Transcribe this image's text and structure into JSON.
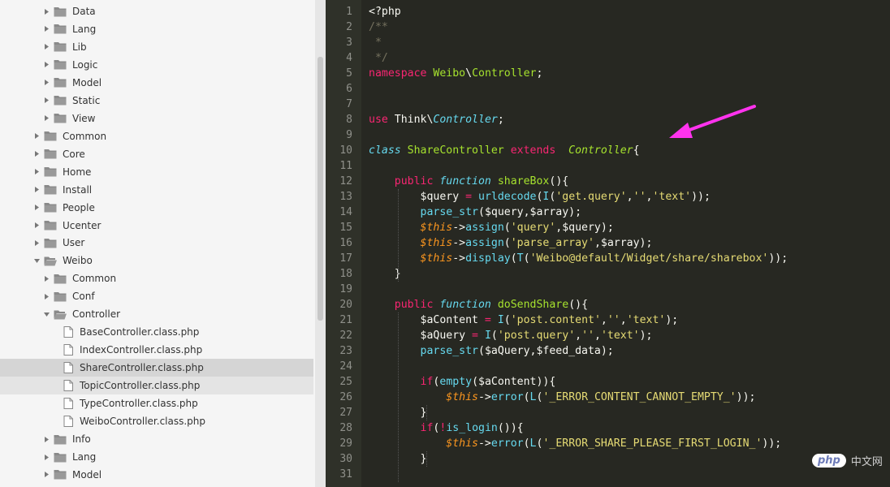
{
  "sidebar": {
    "items": [
      {
        "label": "Data",
        "depth": 2,
        "type": "folder",
        "expanded": false
      },
      {
        "label": "Lang",
        "depth": 2,
        "type": "folder",
        "expanded": false
      },
      {
        "label": "Lib",
        "depth": 2,
        "type": "folder",
        "expanded": false
      },
      {
        "label": "Logic",
        "depth": 2,
        "type": "folder",
        "expanded": false
      },
      {
        "label": "Model",
        "depth": 2,
        "type": "folder",
        "expanded": false
      },
      {
        "label": "Static",
        "depth": 2,
        "type": "folder",
        "expanded": false
      },
      {
        "label": "View",
        "depth": 2,
        "type": "folder",
        "expanded": false
      },
      {
        "label": "Common",
        "depth": 1,
        "type": "folder",
        "expanded": false
      },
      {
        "label": "Core",
        "depth": 1,
        "type": "folder",
        "expanded": false
      },
      {
        "label": "Home",
        "depth": 1,
        "type": "folder",
        "expanded": false
      },
      {
        "label": "Install",
        "depth": 1,
        "type": "folder",
        "expanded": false
      },
      {
        "label": "People",
        "depth": 1,
        "type": "folder",
        "expanded": false
      },
      {
        "label": "Ucenter",
        "depth": 1,
        "type": "folder",
        "expanded": false
      },
      {
        "label": "User",
        "depth": 1,
        "type": "folder",
        "expanded": false
      },
      {
        "label": "Weibo",
        "depth": 1,
        "type": "folder",
        "expanded": true
      },
      {
        "label": "Common",
        "depth": 2,
        "type": "folder",
        "expanded": false
      },
      {
        "label": "Conf",
        "depth": 2,
        "type": "folder",
        "expanded": false
      },
      {
        "label": "Controller",
        "depth": 2,
        "type": "folder",
        "expanded": true
      },
      {
        "label": "BaseController.class.php",
        "depth": 3,
        "type": "file"
      },
      {
        "label": "IndexController.class.php",
        "depth": 3,
        "type": "file"
      },
      {
        "label": "ShareController.class.php",
        "depth": 3,
        "type": "file",
        "state": "selected"
      },
      {
        "label": "TopicController.class.php",
        "depth": 3,
        "type": "file",
        "state": "hover"
      },
      {
        "label": "TypeController.class.php",
        "depth": 3,
        "type": "file"
      },
      {
        "label": "WeiboController.class.php",
        "depth": 3,
        "type": "file"
      },
      {
        "label": "Info",
        "depth": 2,
        "type": "folder",
        "expanded": false
      },
      {
        "label": "Lang",
        "depth": 2,
        "type": "folder",
        "expanded": false
      },
      {
        "label": "Model",
        "depth": 2,
        "type": "folder",
        "expanded": false
      }
    ]
  },
  "editor": {
    "lines": [
      {
        "n": "1",
        "tokens": [
          [
            "<?php",
            ""
          ]
        ]
      },
      {
        "n": "2",
        "tokens": [
          [
            "/**",
            "cm"
          ]
        ]
      },
      {
        "n": "3",
        "tokens": [
          [
            " *",
            "cm"
          ]
        ]
      },
      {
        "n": "4",
        "tokens": [
          [
            " */",
            "cm"
          ]
        ]
      },
      {
        "n": "5",
        "tokens": [
          [
            "namespace",
            "kw"
          ],
          [
            " Weibo",
            "cls"
          ],
          [
            "\\",
            ""
          ],
          [
            "Controller",
            "cls"
          ],
          [
            ";",
            ""
          ]
        ]
      },
      {
        "n": "6",
        "tokens": []
      },
      {
        "n": "7",
        "tokens": []
      },
      {
        "n": "8",
        "tokens": [
          [
            "use",
            "kw"
          ],
          [
            " Think",
            ""
          ],
          [
            "\\",
            ""
          ],
          [
            "Controller",
            "st"
          ],
          [
            ";",
            ""
          ]
        ]
      },
      {
        "n": "9",
        "tokens": []
      },
      {
        "n": "10",
        "tokens": [
          [
            "class",
            "st"
          ],
          [
            " ",
            ""
          ],
          [
            "ShareController",
            "cls"
          ],
          [
            " ",
            ""
          ],
          [
            "extends",
            "kw"
          ],
          [
            "  ",
            ""
          ],
          [
            "Controller",
            "cls it"
          ],
          [
            "{",
            ""
          ]
        ]
      },
      {
        "n": "11",
        "tokens": []
      },
      {
        "n": "12",
        "tokens": [
          [
            "    ",
            ""
          ],
          [
            "public",
            "kw"
          ],
          [
            " ",
            ""
          ],
          [
            "function",
            "st"
          ],
          [
            " ",
            ""
          ],
          [
            "shareBox",
            "fn"
          ],
          [
            "(){",
            ""
          ]
        ]
      },
      {
        "n": "13",
        "tokens": [
          [
            "        $query ",
            ""
          ],
          [
            "=",
            "kw"
          ],
          [
            " ",
            ""
          ],
          [
            "urldecode",
            "bi"
          ],
          [
            "(",
            ""
          ],
          [
            "I",
            "bi"
          ],
          [
            "(",
            ""
          ],
          [
            "'get.query'",
            "str"
          ],
          [
            ",",
            ""
          ],
          [
            "''",
            "str"
          ],
          [
            ",",
            ""
          ],
          [
            "'text'",
            "str"
          ],
          [
            "));",
            ""
          ]
        ]
      },
      {
        "n": "14",
        "tokens": [
          [
            "        ",
            ""
          ],
          [
            "parse_str",
            "bi"
          ],
          [
            "($query,$array);",
            ""
          ]
        ]
      },
      {
        "n": "15",
        "tokens": [
          [
            "        ",
            ""
          ],
          [
            "$this",
            "var"
          ],
          [
            "->",
            ""
          ],
          [
            "assign",
            "bi"
          ],
          [
            "(",
            ""
          ],
          [
            "'query'",
            "str"
          ],
          [
            ",$query);",
            ""
          ]
        ]
      },
      {
        "n": "16",
        "tokens": [
          [
            "        ",
            ""
          ],
          [
            "$this",
            "var"
          ],
          [
            "->",
            ""
          ],
          [
            "assign",
            "bi"
          ],
          [
            "(",
            ""
          ],
          [
            "'parse_array'",
            "str"
          ],
          [
            ",$array);",
            ""
          ]
        ]
      },
      {
        "n": "17",
        "tokens": [
          [
            "        ",
            ""
          ],
          [
            "$this",
            "var"
          ],
          [
            "->",
            ""
          ],
          [
            "display",
            "bi"
          ],
          [
            "(",
            ""
          ],
          [
            "T",
            "bi"
          ],
          [
            "(",
            ""
          ],
          [
            "'Weibo@default/Widget/share/sharebox'",
            "str"
          ],
          [
            "));",
            ""
          ]
        ]
      },
      {
        "n": "18",
        "tokens": [
          [
            "    }",
            ""
          ]
        ]
      },
      {
        "n": "19",
        "tokens": []
      },
      {
        "n": "20",
        "tokens": [
          [
            "    ",
            ""
          ],
          [
            "public",
            "kw"
          ],
          [
            " ",
            ""
          ],
          [
            "function",
            "st"
          ],
          [
            " ",
            ""
          ],
          [
            "doSendShare",
            "fn"
          ],
          [
            "(){",
            ""
          ]
        ]
      },
      {
        "n": "21",
        "tokens": [
          [
            "        $aContent ",
            ""
          ],
          [
            "=",
            "kw"
          ],
          [
            " ",
            ""
          ],
          [
            "I",
            "bi"
          ],
          [
            "(",
            ""
          ],
          [
            "'post.content'",
            "str"
          ],
          [
            ",",
            ""
          ],
          [
            "''",
            "str"
          ],
          [
            ",",
            ""
          ],
          [
            "'text'",
            "str"
          ],
          [
            ");",
            ""
          ]
        ]
      },
      {
        "n": "22",
        "tokens": [
          [
            "        $aQuery ",
            ""
          ],
          [
            "=",
            "kw"
          ],
          [
            " ",
            ""
          ],
          [
            "I",
            "bi"
          ],
          [
            "(",
            ""
          ],
          [
            "'post.query'",
            "str"
          ],
          [
            ",",
            ""
          ],
          [
            "''",
            "str"
          ],
          [
            ",",
            ""
          ],
          [
            "'text'",
            "str"
          ],
          [
            ");",
            ""
          ]
        ]
      },
      {
        "n": "23",
        "tokens": [
          [
            "        ",
            ""
          ],
          [
            "parse_str",
            "bi"
          ],
          [
            "($aQuery,$feed_data);",
            ""
          ]
        ]
      },
      {
        "n": "24",
        "tokens": []
      },
      {
        "n": "25",
        "tokens": [
          [
            "        ",
            ""
          ],
          [
            "if",
            "kw"
          ],
          [
            "(",
            ""
          ],
          [
            "empty",
            "bi"
          ],
          [
            "($aContent)){",
            ""
          ]
        ]
      },
      {
        "n": "26",
        "tokens": [
          [
            "            ",
            ""
          ],
          [
            "$this",
            "var"
          ],
          [
            "->",
            ""
          ],
          [
            "error",
            "bi"
          ],
          [
            "(",
            ""
          ],
          [
            "L",
            "bi"
          ],
          [
            "(",
            ""
          ],
          [
            "'_ERROR_CONTENT_CANNOT_EMPTY_'",
            "str"
          ],
          [
            "));",
            ""
          ]
        ]
      },
      {
        "n": "27",
        "tokens": [
          [
            "        }",
            ""
          ]
        ]
      },
      {
        "n": "28",
        "tokens": [
          [
            "        ",
            ""
          ],
          [
            "if",
            "kw"
          ],
          [
            "(",
            ""
          ],
          [
            "!",
            "kw"
          ],
          [
            "is_login",
            "bi"
          ],
          [
            "()){",
            ""
          ]
        ]
      },
      {
        "n": "29",
        "tokens": [
          [
            "            ",
            ""
          ],
          [
            "$this",
            "var"
          ],
          [
            "->",
            ""
          ],
          [
            "error",
            "bi"
          ],
          [
            "(",
            ""
          ],
          [
            "L",
            "bi"
          ],
          [
            "(",
            ""
          ],
          [
            "'_ERROR_SHARE_PLEASE_FIRST_LOGIN_'",
            "str"
          ],
          [
            "));",
            ""
          ]
        ]
      },
      {
        "n": "30",
        "tokens": [
          [
            "        }",
            ""
          ]
        ]
      },
      {
        "n": "31",
        "tokens": []
      }
    ]
  },
  "watermark": {
    "logo": "php",
    "text": "中文网"
  },
  "colors": {
    "annotation_arrow": "#ff33ee",
    "editor_bg": "#272822",
    "sidebar_bg": "#f5f5f5"
  }
}
